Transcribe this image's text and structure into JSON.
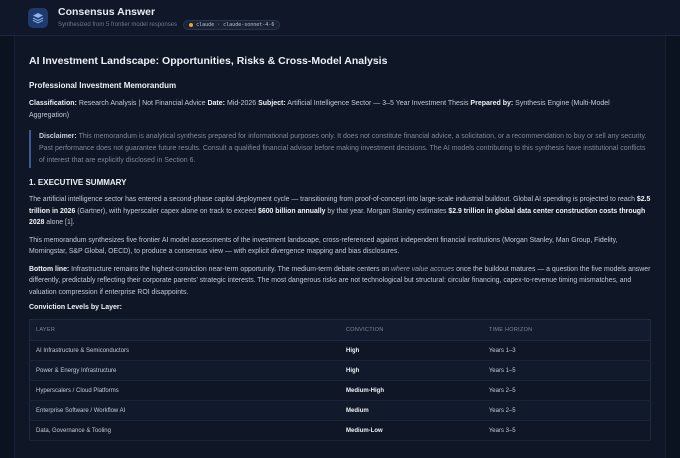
{
  "header": {
    "title": "Consensus Answer",
    "subtitle": "Synthesized from 5 frontier model responses",
    "model_badge": "claude · claude-sonnet-4-6"
  },
  "doc": {
    "title": "AI Investment Landscape: Opportunities, Risks & Cross-Model Analysis",
    "memo_heading": "Professional Investment Memorandum",
    "meta": {
      "classification_label": "Classification:",
      "classification_value": "Research Analysis | Not Financial Advice",
      "date_label": "Date:",
      "date_value": "Mid-2026",
      "subject_label": "Subject:",
      "subject_value": "Artificial Intelligence Sector — 3–5 Year Investment Thesis",
      "prepared_label": "Prepared by:",
      "prepared_value": "Synthesis Engine (Multi-Model Aggregation)"
    },
    "disclaimer": {
      "label": "Disclaimer:",
      "text": "This memorandum is analytical synthesis prepared for informational purposes only. It does not constitute financial advice, a solicitation, or a recommendation to buy or sell any security. Past performance does not guarantee future results. Consult a qualified financial advisor before making investment decisions. The AI models contributing to this synthesis have institutional conflicts of interest that are explicitly disclosed in Section 6."
    },
    "section1": {
      "heading": "1. EXECUTIVE SUMMARY",
      "p1_a": "The artificial intelligence sector has entered a second-phase capital deployment cycle — transitioning from proof-of-concept into large-scale industrial buildout. Global AI spending is projected to reach ",
      "p1_b1": "$2.5 trillion in 2026",
      "p1_c": " (Gartner), with hyperscaler capex alone on track to exceed ",
      "p1_b2": "$600 billion annually",
      "p1_d": " by that year. Morgan Stanley estimates ",
      "p1_b3": "$2.9 trillion in global data center construction costs through 2028",
      "p1_e": " alone [1].",
      "p2": "This memorandum synthesizes five frontier AI model assessments of the investment landscape, cross-referenced against independent financial institutions (Morgan Stanley, Man Group, Fidelity, Morningstar, S&P Global, OECD), to produce a consensus view — with explicit divergence mapping and bias disclosures.",
      "p3_label": "Bottom line:",
      "p3_a": " Infrastructure remains the highest-conviction near-term opportunity. The medium-term debate centers on ",
      "p3_em": "where value accrues",
      "p3_b": " once the buildout matures — a question the five models answer differently, predictably reflecting their corporate parents' strategic interests. The most dangerous risks are not technological but structural: circular financing, capex-to-revenue timing mismatches, and valuation compression if enterprise ROI disappoints.",
      "conviction_label": "Conviction Levels by Layer:"
    },
    "table": {
      "headers": [
        "LAYER",
        "CONVICTION",
        "TIME HORIZON"
      ],
      "rows": [
        [
          "AI Infrastructure & Semiconductors",
          "High",
          "Years 1–3"
        ],
        [
          "Power & Energy Infrastructure",
          "High",
          "Years 1–5"
        ],
        [
          "Hyperscalers / Cloud Platforms",
          "Medium-High",
          "Years 2–5"
        ],
        [
          "Enterprise Software / Workflow AI",
          "Medium",
          "Years 2–5"
        ],
        [
          "Data, Governance & Tooling",
          "Medium-Low",
          "Years 3–5"
        ]
      ]
    }
  }
}
